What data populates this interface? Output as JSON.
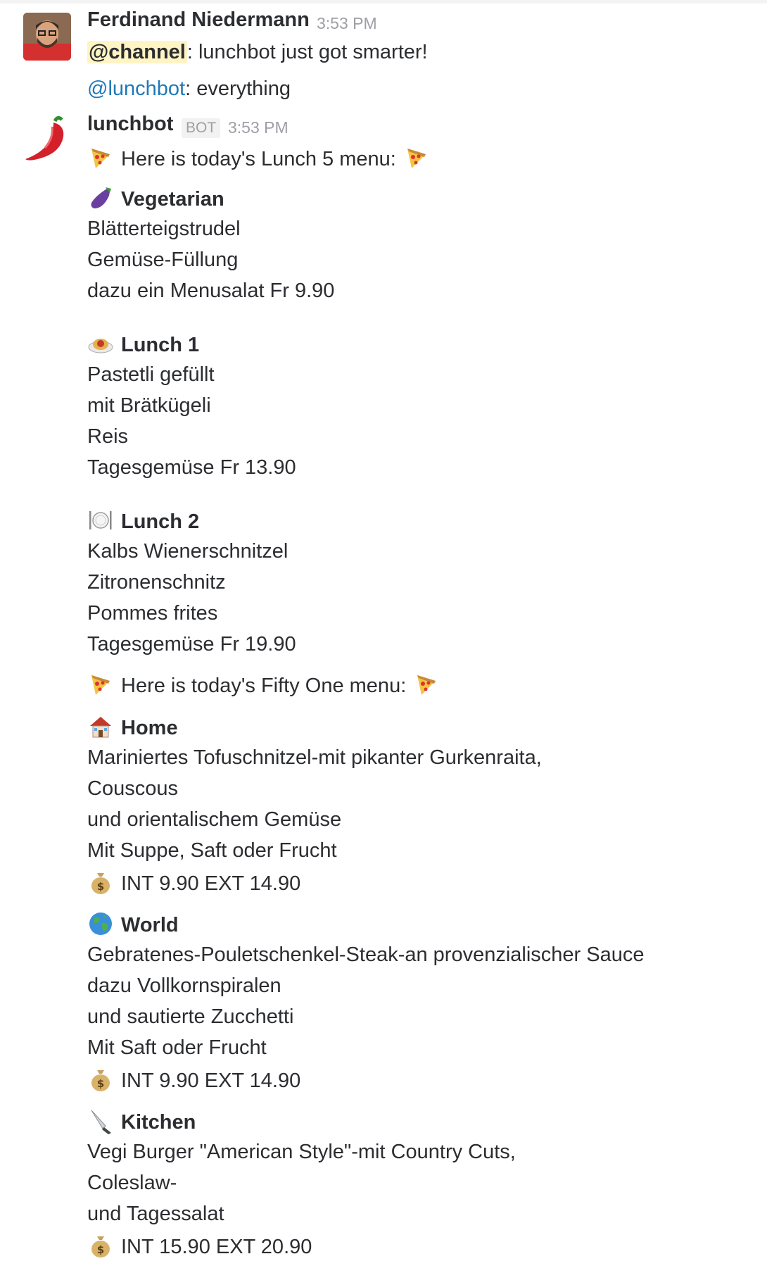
{
  "message1": {
    "sender": "Ferdinand Niedermann",
    "time": "3:53 PM",
    "mention": "@channel",
    "text": ": lunchbot just got smarter!",
    "second_mention": "@lunchbot",
    "second_text": ": everything"
  },
  "message2": {
    "sender": "lunchbot",
    "badge": "BOT",
    "time": "3:53 PM",
    "avatar_icon": "chili-pepper-icon",
    "intro1": "Here is today's Lunch 5 menu:",
    "sections_lunch5": [
      {
        "icon": "eggplant-icon",
        "title": "Vegetarian",
        "lines": [
          "Blätterteigstrudel",
          "Gemüse-Füllung",
          "dazu ein Menusalat Fr 9.90"
        ]
      },
      {
        "icon": "spaghetti-icon",
        "title": "Lunch 1",
        "lines": [
          "Pastetli gefüllt",
          "mit Brätkügeli",
          "Reis",
          "Tagesgemüse Fr 13.90"
        ]
      },
      {
        "icon": "fork-knife-plate-icon",
        "title": "Lunch 2",
        "lines": [
          "Kalbs Wienerschnitzel",
          "Zitronenschnitz",
          "Pommes frites",
          "Tagesgemüse Fr 19.90"
        ]
      }
    ],
    "intro2": "Here is today's Fifty One menu:",
    "sections_fifty_one": [
      {
        "icon": "house-icon",
        "title": "Home",
        "lines": [
          "Mariniertes Tofuschnitzel-mit pikanter Gurkenraita,",
          "Couscous",
          "und orientalischem Gemüse",
          "Mit Suppe, Saft oder Frucht"
        ],
        "price": "INT 9.90 EXT 14.90"
      },
      {
        "icon": "globe-icon",
        "title": "World",
        "lines": [
          "Gebratenes-Pouletschenkel-Steak-an provenzialischer Sauce",
          "dazu Vollkornspiralen",
          "und sautierte Zucchetti",
          "Mit Saft oder Frucht"
        ],
        "price": "INT 9.90 EXT 14.90"
      },
      {
        "icon": "knife-icon",
        "title": "Kitchen",
        "lines": [
          "Vegi Burger \"American Style\"-mit Country Cuts,",
          "Coleslaw-",
          "und Tagessalat"
        ],
        "price": "INT 15.90 EXT 20.90"
      }
    ],
    "price_icon": "money-bag-icon"
  },
  "colors": {
    "mention_highlight": "#fff4c4",
    "link": "#1f79b8",
    "text": "#2c2d30",
    "muted": "#9e9ea6"
  }
}
